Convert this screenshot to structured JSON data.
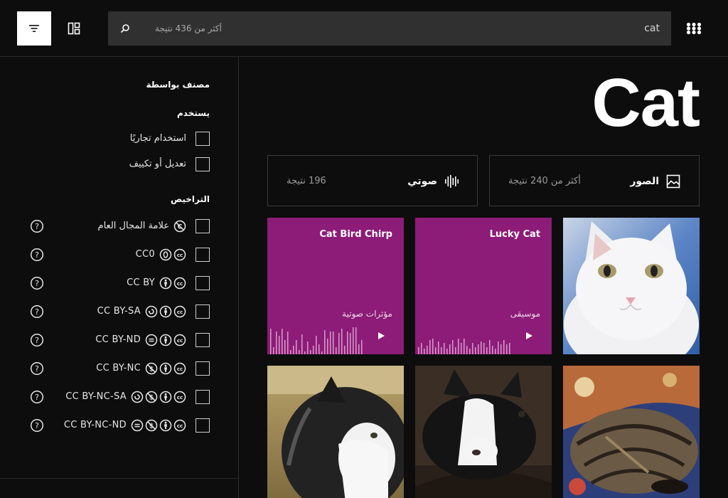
{
  "header": {
    "search": {
      "query": "cat",
      "results_hint": "أكثر من 436 نتيجة"
    }
  },
  "sidebar": {
    "sort_heading": "مصنف بواسطة",
    "use_heading": "يستخدم",
    "use_options": [
      {
        "label": "استخدام تجاريًا"
      },
      {
        "label": "تعديل أو تكييف"
      }
    ],
    "licenses_heading": "التراخيص",
    "licenses": [
      {
        "label": "علامة المجال العام",
        "icons": [
          "pd-icon"
        ]
      },
      {
        "label": "CC0",
        "icons": [
          "zero-icon",
          "cc-icon"
        ]
      },
      {
        "label": "CC BY",
        "icons": [
          "by-icon",
          "cc-icon"
        ]
      },
      {
        "label": "CC BY-SA",
        "icons": [
          "sa-icon",
          "by-icon",
          "cc-icon"
        ]
      },
      {
        "label": "CC BY-ND",
        "icons": [
          "nd-icon",
          "by-icon",
          "cc-icon"
        ]
      },
      {
        "label": "CC BY-NC",
        "icons": [
          "nc-icon",
          "by-icon",
          "cc-icon"
        ]
      },
      {
        "label": "CC BY-NC-SA",
        "icons": [
          "sa-icon",
          "nc-icon",
          "by-icon",
          "cc-icon"
        ]
      },
      {
        "label": "CC BY-NC-ND",
        "icons": [
          "nd-icon",
          "nc-icon",
          "by-icon",
          "cc-icon"
        ]
      }
    ]
  },
  "main": {
    "title": "Cat",
    "type_cards": [
      {
        "label": "الصور",
        "count": "أكثر من 240 نتيجة",
        "icon": "image-icon"
      },
      {
        "label": "صوتي",
        "count": "196 نتيجة",
        "icon": "audio-wave-icon"
      }
    ],
    "audio_results": [
      {
        "title": "Cat Bird Chirp",
        "category": "مؤثرات صوتية"
      },
      {
        "title": "Lucky Cat",
        "category": "موسيقى"
      }
    ]
  },
  "colors": {
    "background": "#0d0d0d",
    "search_bg": "#303030",
    "audio_tile": "#8c1c77"
  }
}
